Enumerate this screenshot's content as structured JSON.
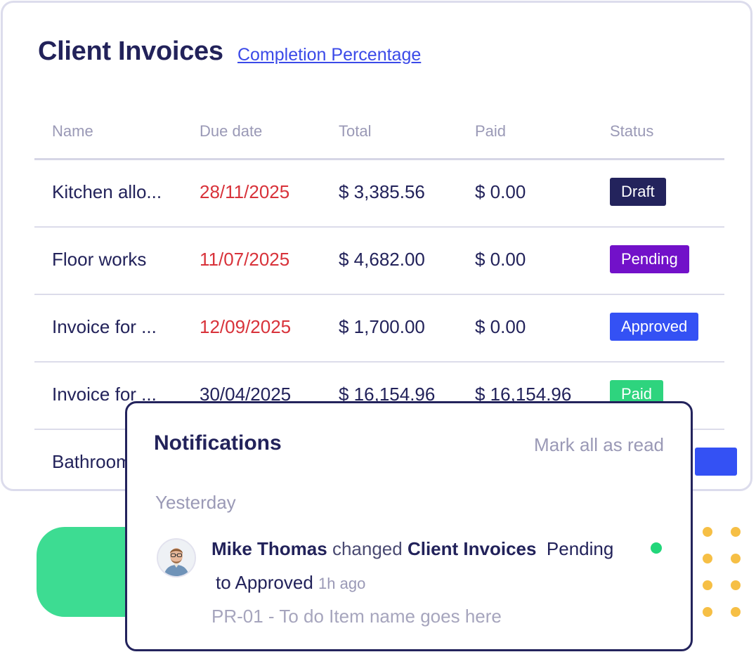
{
  "card": {
    "title": "Client Invoices",
    "link": "Completion Percentage"
  },
  "table": {
    "headers": [
      "Name",
      "Due date",
      "Total",
      "Paid",
      "Status"
    ],
    "rows": [
      {
        "name": "Kitchen allo...",
        "due": "28/11/2025",
        "total": "$ 3,385.56",
        "paid": "$ 0.00",
        "status": "Draft"
      },
      {
        "name": "Floor works",
        "due": "11/07/2025",
        "total": "$ 4,682.00",
        "paid": "$ 0.00",
        "status": "Pending"
      },
      {
        "name": "Invoice for ...",
        "due": "12/09/2025",
        "total": "$ 1,700.00",
        "paid": "$ 0.00",
        "status": "Approved"
      },
      {
        "name": "Invoice for ...",
        "due": "30/04/2025",
        "total": "$ 16,154.96",
        "paid": "$ 16,154.96",
        "status": "Paid"
      },
      {
        "name": "Bathroom",
        "due": "",
        "total": "",
        "paid": "",
        "status": ""
      }
    ]
  },
  "status_colors": {
    "Draft": "#23235c",
    "Pending": "#7211c9",
    "Approved": "#3451f4",
    "Paid": "#2ed47e"
  },
  "due_overdue_color": "#d8323a",
  "notifications": {
    "title": "Notifications",
    "mark_all": "Mark all as read",
    "group": "Yesterday",
    "item": {
      "user": "Mike Thomas",
      "action": "changed",
      "target": "Client Invoices",
      "from": "Pending",
      "to_word": "to",
      "to": "Approved",
      "time": "1h ago",
      "detail": "PR-01 - To do Item name goes here",
      "avatar_icon": "user-avatar"
    }
  }
}
